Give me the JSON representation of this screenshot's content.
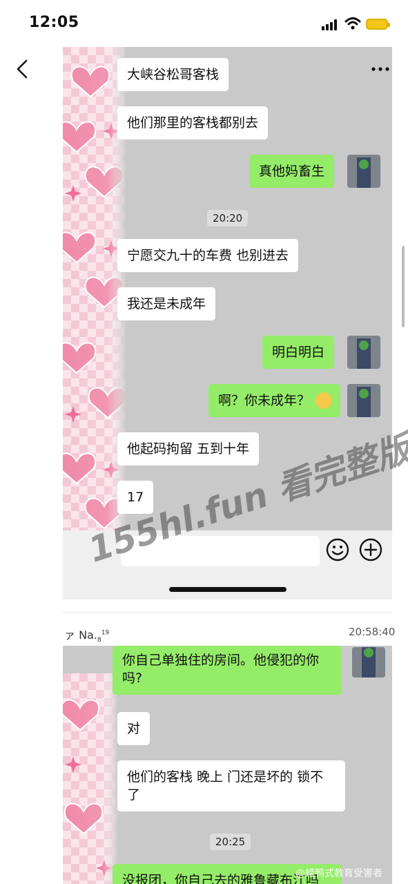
{
  "status_bar": {
    "time": "12:05"
  },
  "chat1": {
    "messages": [
      {
        "side": "in",
        "text": "大峡谷松哥客栈"
      },
      {
        "side": "in",
        "text": "他们那里的客栈都别去"
      },
      {
        "side": "out",
        "text": "真他妈畜生"
      },
      {
        "side": "time",
        "text": "20:20"
      },
      {
        "side": "in",
        "text": "宁愿交九十的车费 也别进去"
      },
      {
        "side": "in",
        "text": "我还是未成年"
      },
      {
        "side": "out",
        "text": "明白明白"
      },
      {
        "side": "out",
        "text": "啊？你未成年？"
      },
      {
        "side": "in",
        "text": "他起码拘留 五到十年"
      },
      {
        "side": "in",
        "text": "17"
      }
    ]
  },
  "post_meta": {
    "sender": "ァ Na.",
    "sender_sub": "8",
    "sender_sup": "19",
    "time": "20:58:40"
  },
  "chat2": {
    "messages": [
      {
        "side": "out",
        "text": "你自己单独住的房间。他侵犯的你吗?"
      },
      {
        "side": "in",
        "text": "对"
      },
      {
        "side": "in",
        "text": "他们的客栈 晚上 门还是坏的 锁不了"
      },
      {
        "side": "time",
        "text": "20:25"
      },
      {
        "side": "out",
        "text": "没报团，你自己去的雅鲁藏布江吗"
      }
    ]
  },
  "watermarks": {
    "main": "155hl.fun 看完整版",
    "weibo": "@蜡鸭式教育受害者"
  },
  "colors": {
    "bubble_out": "#95ec69",
    "bubble_in": "#ffffff",
    "chat_bg": "#c9c9c9",
    "battery": "#f5c518"
  },
  "icons": [
    "back-icon",
    "more-icon",
    "emoji-icon",
    "plus-icon",
    "signal-icon",
    "wifi-icon",
    "battery-icon"
  ]
}
